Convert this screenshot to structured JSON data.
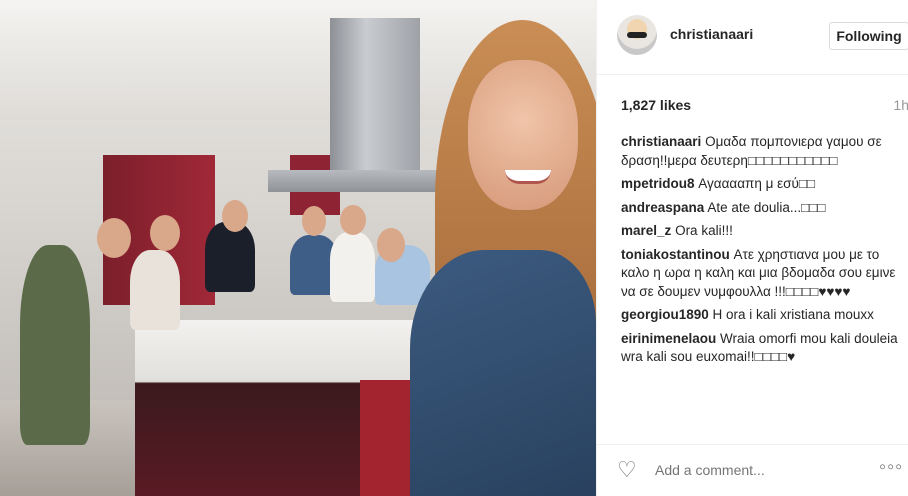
{
  "post": {
    "username": "christianaari",
    "follow_label": "Following",
    "likes": "1,827 likes",
    "time": "1h"
  },
  "comments": [
    {
      "user": "christianaari",
      "text": "Ομαδα πομπονιερα γαμου σε δραση!!μερα δευτερη□□□□□□□□□□□"
    },
    {
      "user": "mpetridou8",
      "text": "Αγααααπη μ εσύ□□"
    },
    {
      "user": "andreaspana",
      "text": "Ate ate doulia...□□□"
    },
    {
      "user": "marel_z",
      "text": "Ora kali!!!"
    },
    {
      "user": "toniakostantinou",
      "text": "Ατε χρηστιανα μου με το καλο η ωρα η καλη και μια βδομαδα σου εμινε να σε δουμεν νυμφουλλα !!!□□□□♥♥♥♥"
    },
    {
      "user": "georgiou1890",
      "text": "H ora i kali xristiana mouxx"
    },
    {
      "user": "eirinimenelaou",
      "text": "Wraia omorfi mou kali douleia wra kali sou euxomai!!□□□□♥"
    }
  ],
  "footer": {
    "add_comment_placeholder": "Add a comment...",
    "more_label": "◦◦◦"
  },
  "icons": {
    "heart": "heart-icon",
    "more": "more-options-icon",
    "avatar": "avatar"
  }
}
